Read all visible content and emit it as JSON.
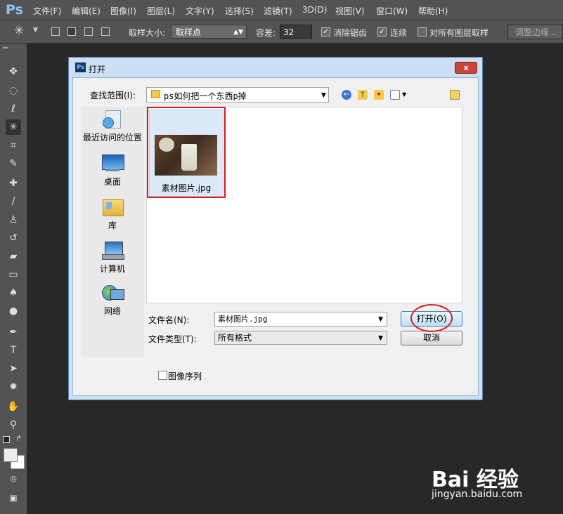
{
  "app": {
    "logo": "Ps"
  },
  "menu": [
    "文件(F)",
    "编辑(E)",
    "图像(I)",
    "图层(L)",
    "文字(Y)",
    "选择(S)",
    "滤镜(T)",
    "3D(D)",
    "视图(V)",
    "窗口(W)",
    "帮助(H)"
  ],
  "options": {
    "sample_size_label": "取样大小:",
    "sample_size_value": "取样点",
    "tolerance_label": "容差:",
    "tolerance_value": "32",
    "antialias_label": "消除锯齿",
    "contiguous_label": "连续",
    "all_layers_label": "对所有图层取样",
    "refine_edge_label": "调整边缘..."
  },
  "dialog": {
    "title": "打开",
    "close": "x",
    "look_in_label": "查找范围(I):",
    "look_in_value": "ps如何把一个东西p掉",
    "places": [
      "最近访问的位置",
      "桌面",
      "库",
      "计算机",
      "网络"
    ],
    "file": {
      "name": "素材图片.jpg"
    },
    "filename_label": "文件名(N):",
    "filename_value": "素材图片.jpg",
    "filetype_label": "文件类型(T):",
    "filetype_value": "所有格式",
    "open_button": "打开(O)",
    "cancel_button": "取消",
    "image_sequence_label": "图像序列"
  },
  "watermark": {
    "brand": "Bai 经验",
    "url": "jingyan.baidu.com"
  }
}
